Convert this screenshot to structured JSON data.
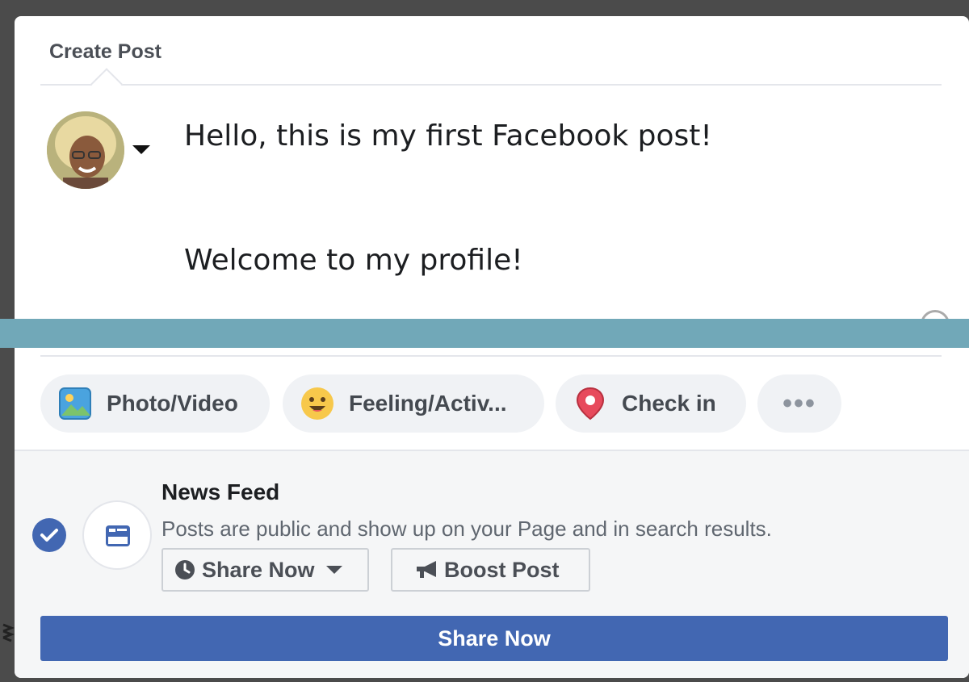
{
  "dialog": {
    "title": "Create Post"
  },
  "composer": {
    "line1": "Hello, this is my first Facebook post!",
    "line2": "Welcome to my profile!"
  },
  "actions": [
    {
      "label": "Photo/Video",
      "icon": "photo-video-icon"
    },
    {
      "label": "Feeling/Activ...",
      "icon": "smiley-icon"
    },
    {
      "label": "Check in",
      "icon": "location-pin-icon"
    },
    {
      "label": "•••",
      "icon": "more-icon"
    }
  ],
  "audience": {
    "title": "News Feed",
    "description": "Posts are public and show up on your Page and in search results.",
    "checked": true
  },
  "buttons": {
    "schedule_label": "Share Now",
    "boost_label": "Boost Post",
    "primary_label": "Share Now"
  },
  "colors": {
    "primary": "#4267b2",
    "banner": "#71a8b8",
    "pill_bg": "#f0f2f5"
  }
}
